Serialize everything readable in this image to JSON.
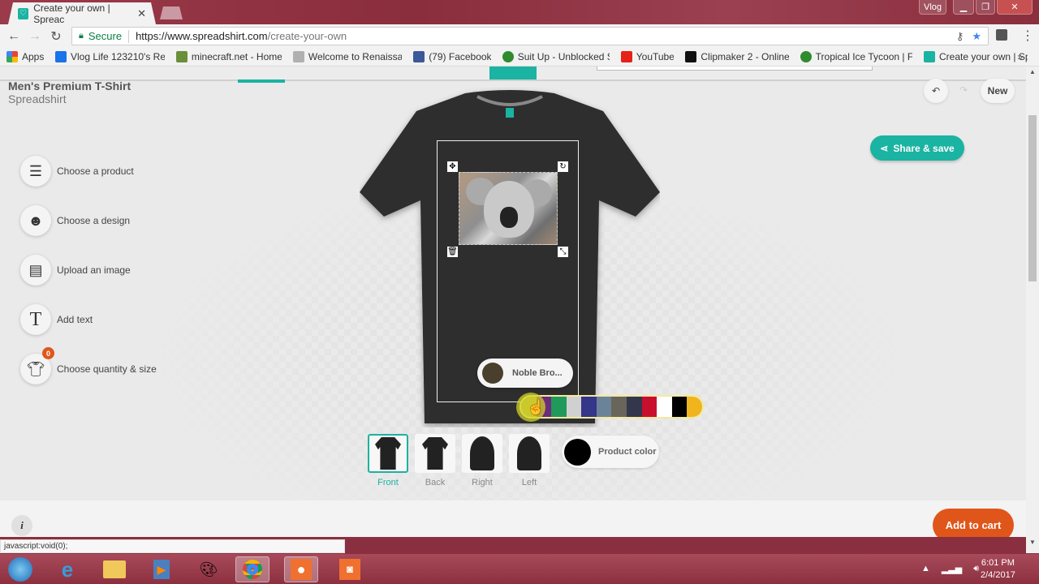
{
  "browser": {
    "tab_title": "Create your own | Spreac",
    "window_user": "Vlog",
    "secure_label": "Secure",
    "url_host": "https://www.spreadshirt.com",
    "url_path": "/create-your-own",
    "bookmarks": [
      {
        "label": "Apps",
        "icon": "apps-grid-icon",
        "color": "#e94235"
      },
      {
        "label": "Vlog Life 123210's Re",
        "icon": "vlog-icon",
        "color": "#1a73e8"
      },
      {
        "label": "minecraft.net - Home",
        "icon": "minecraft-icon",
        "color": "#6a8f3a"
      },
      {
        "label": "Welcome to Renaissa",
        "icon": "rl-icon",
        "color": "#b0b0b0"
      },
      {
        "label": "(79) Facebook",
        "icon": "facebook-icon",
        "color": "#3b5998"
      },
      {
        "label": "Suit Up - Unblocked S",
        "icon": "suit-up-icon",
        "color": "#2e8b2e"
      },
      {
        "label": "YouTube",
        "icon": "youtube-icon",
        "color": "#e62117"
      },
      {
        "label": "Clipmaker 2 - Online",
        "icon": "clipmaker-icon",
        "color": "#111111"
      },
      {
        "label": "Tropical Ice Tycoon | F",
        "icon": "tropical-icon",
        "color": "#2e8b2e"
      },
      {
        "label": "Create your own | Spr",
        "icon": "spreadshirt-icon",
        "color": "#1bb3a1"
      }
    ],
    "status_text": "javascript:void(0);"
  },
  "product": {
    "title": "Men's Premium T-Shirt",
    "brand": "Spreadshirt"
  },
  "sidebar": {
    "items": [
      {
        "label": "Choose a product",
        "icon": "shirt-stack-icon"
      },
      {
        "label": "Choose a design",
        "icon": "smiley-icon"
      },
      {
        "label": "Upload an image",
        "icon": "upload-image-icon"
      },
      {
        "label": "Add text",
        "icon": "text-icon"
      },
      {
        "label": "Choose quantity & size",
        "icon": "quantity-icon",
        "badge": "0"
      }
    ]
  },
  "toolbar": {
    "new_label": "New",
    "share_label": "Share & save"
  },
  "design_color": {
    "label": "Noble Bro...",
    "value": "#4a3f2c",
    "swatches": [
      "#b5b038",
      "#6b2d7a",
      "#1f9a5a",
      "#d0d0d0",
      "#35358a",
      "#6b8399",
      "#6a655a",
      "#33374d",
      "#c8102e",
      "#ffffff",
      "#000000",
      "#f0b41c"
    ]
  },
  "views": [
    {
      "label": "Front",
      "active": true
    },
    {
      "label": "Back",
      "active": false
    },
    {
      "label": "Right",
      "active": false
    },
    {
      "label": "Left",
      "active": false
    }
  ],
  "product_color": {
    "label": "Product color",
    "value": "#000000"
  },
  "cart": {
    "label": "Add to cart"
  },
  "accent_color": "#1bb3a1",
  "cart_color": "#e0561a",
  "taskbar": {
    "time": "6:01 PM",
    "date": "2/4/2017"
  }
}
